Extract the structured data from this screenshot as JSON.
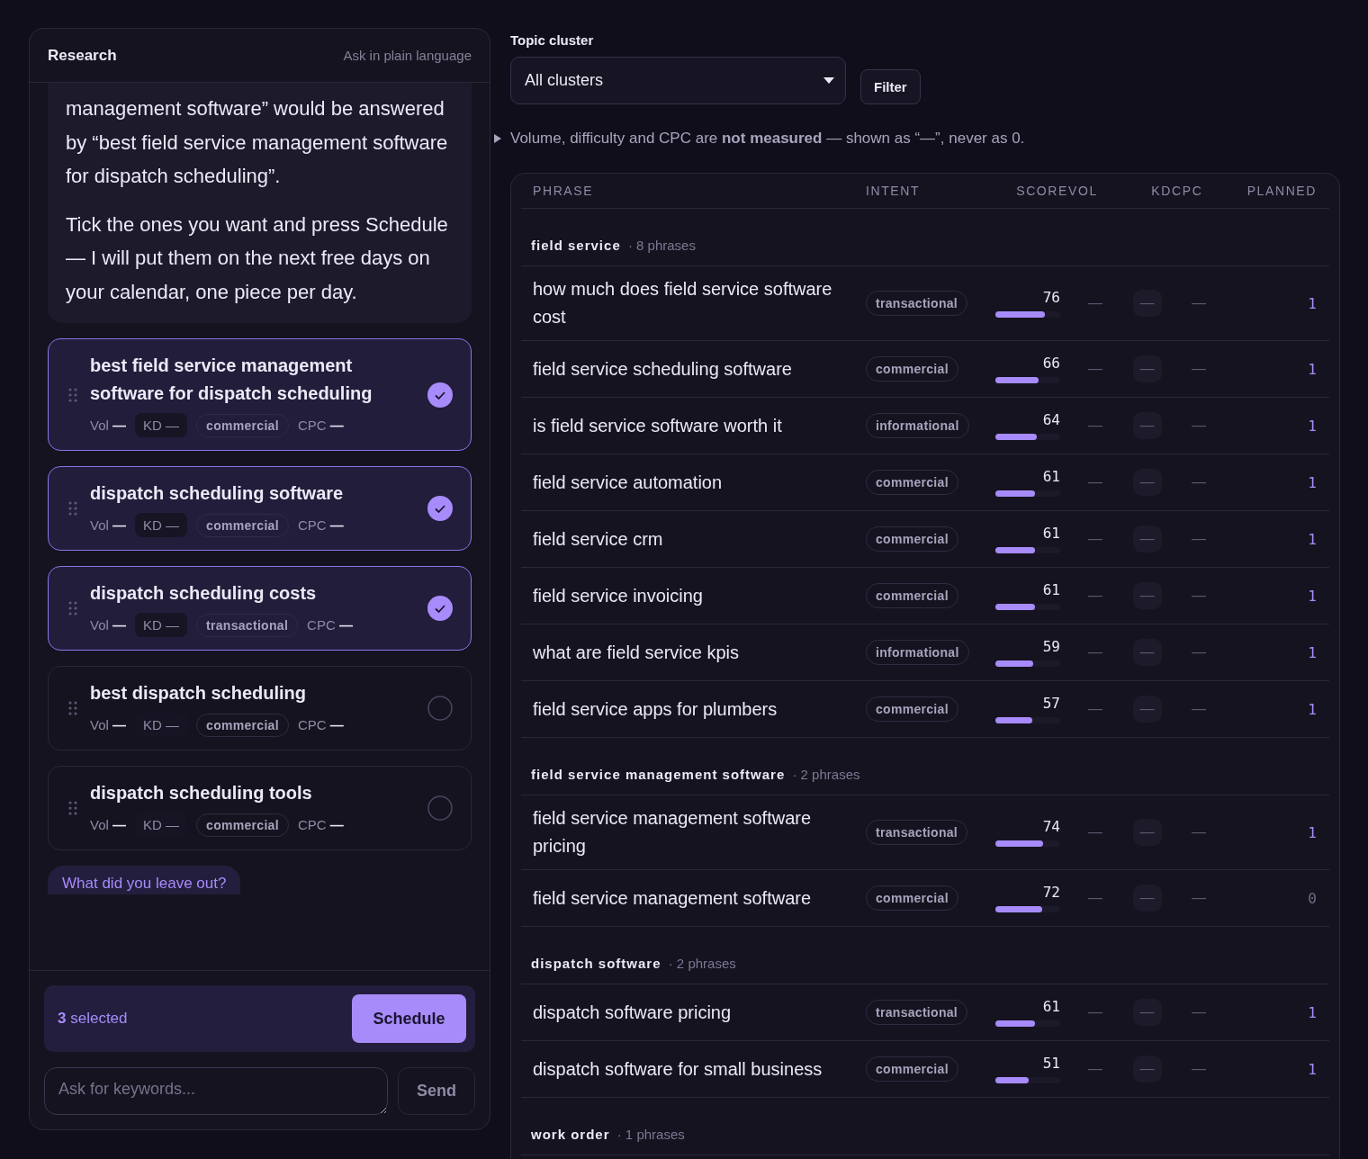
{
  "research": {
    "title": "Research",
    "hint": "Ask in plain language",
    "message": [
      "management software” would be answered by “best field service management software for dispatch scheduling”.",
      "Tick the ones you want and press Schedule — I will put them on the next free days on your calendar, one piece per day."
    ],
    "suggestions": [
      {
        "title": "best field service management software for dispatch scheduling",
        "vol": {
          "label": "Vol",
          "value": "—"
        },
        "kd": {
          "label": "KD",
          "value": "—"
        },
        "intent": "commercial",
        "cpc": {
          "label": "CPC",
          "value": "—"
        },
        "selected": true
      },
      {
        "title": "dispatch scheduling software",
        "vol": {
          "label": "Vol",
          "value": "—"
        },
        "kd": {
          "label": "KD",
          "value": "—"
        },
        "intent": "commercial",
        "cpc": {
          "label": "CPC",
          "value": "—"
        },
        "selected": true
      },
      {
        "title": "dispatch scheduling costs",
        "vol": {
          "label": "Vol",
          "value": "—"
        },
        "kd": {
          "label": "KD",
          "value": "—"
        },
        "intent": "transactional",
        "cpc": {
          "label": "CPC",
          "value": "—"
        },
        "selected": true
      },
      {
        "title": "best dispatch scheduling",
        "vol": {
          "label": "Vol",
          "value": "—"
        },
        "kd": {
          "label": "KD",
          "value": "—"
        },
        "intent": "commercial",
        "cpc": {
          "label": "CPC",
          "value": "—"
        },
        "selected": false
      },
      {
        "title": "dispatch scheduling tools",
        "vol": {
          "label": "Vol",
          "value": "—"
        },
        "kd": {
          "label": "KD",
          "value": "—"
        },
        "intent": "commercial",
        "cpc": {
          "label": "CPC",
          "value": "—"
        },
        "selected": false
      }
    ],
    "followup": "What did you leave out?",
    "selection": {
      "text": "**3** selected",
      "button": "Schedule"
    },
    "input": {
      "placeholder": "Ask for keywords...",
      "button": "Send"
    }
  },
  "filter": {
    "label": "Topic cluster",
    "value": "All clusters",
    "button": "Filter"
  },
  "note": "Volume, difficulty and CPC are **not measured** — shown as “—”, never as 0.",
  "table": {
    "columns": [
      "PHRASE",
      "INTENT",
      "SCORE",
      "VOL",
      "KD",
      "CPC",
      "PLANNED"
    ],
    "groups": [
      {
        "name": "field service",
        "count": "· 8 phrases",
        "rows": [
          {
            "phrase": "how much does field service software cost",
            "intent": "transactional",
            "score": "76",
            "level": 0.76,
            "vol": "—",
            "kd": "—",
            "cpc": "—",
            "planned": "1",
            "active": true
          },
          {
            "phrase": "field service scheduling software",
            "intent": "commercial",
            "score": "66",
            "level": 0.66,
            "vol": "—",
            "kd": "—",
            "cpc": "—",
            "planned": "1",
            "active": true
          },
          {
            "phrase": "is field service software worth it",
            "intent": "informational",
            "score": "64",
            "level": 0.64,
            "vol": "—",
            "kd": "—",
            "cpc": "—",
            "planned": "1",
            "active": true
          },
          {
            "phrase": "field service automation",
            "intent": "commercial",
            "score": "61",
            "level": 0.61,
            "vol": "—",
            "kd": "—",
            "cpc": "—",
            "planned": "1",
            "active": true
          },
          {
            "phrase": "field service crm",
            "intent": "commercial",
            "score": "61",
            "level": 0.61,
            "vol": "—",
            "kd": "—",
            "cpc": "—",
            "planned": "1",
            "active": true
          },
          {
            "phrase": "field service invoicing",
            "intent": "commercial",
            "score": "61",
            "level": 0.61,
            "vol": "—",
            "kd": "—",
            "cpc": "—",
            "planned": "1",
            "active": true
          },
          {
            "phrase": "what are field service kpis",
            "intent": "informational",
            "score": "59",
            "level": 0.59,
            "vol": "—",
            "kd": "—",
            "cpc": "—",
            "planned": "1",
            "active": true
          },
          {
            "phrase": "field service apps for plumbers",
            "intent": "commercial",
            "score": "57",
            "level": 0.57,
            "vol": "—",
            "kd": "—",
            "cpc": "—",
            "planned": "1",
            "active": true
          }
        ]
      },
      {
        "name": "field service management software",
        "count": "· 2 phrases",
        "rows": [
          {
            "phrase": "field service management software pricing",
            "intent": "transactional",
            "score": "74",
            "level": 0.74,
            "vol": "—",
            "kd": "—",
            "cpc": "—",
            "planned": "1",
            "active": true
          },
          {
            "phrase": "field service management software",
            "intent": "commercial",
            "score": "72",
            "level": 0.72,
            "vol": "—",
            "kd": "—",
            "cpc": "—",
            "planned": "0",
            "active": false
          }
        ]
      },
      {
        "name": "dispatch software",
        "count": "· 2 phrases",
        "rows": [
          {
            "phrase": "dispatch software pricing",
            "intent": "transactional",
            "score": "61",
            "level": 0.61,
            "vol": "—",
            "kd": "—",
            "cpc": "—",
            "planned": "1",
            "active": true
          },
          {
            "phrase": "dispatch software for small business",
            "intent": "commercial",
            "score": "51",
            "level": 0.51,
            "vol": "—",
            "kd": "—",
            "cpc": "—",
            "planned": "1",
            "active": true
          }
        ]
      },
      {
        "name": "work order",
        "count": "· 1 phrases"
      }
    ]
  }
}
